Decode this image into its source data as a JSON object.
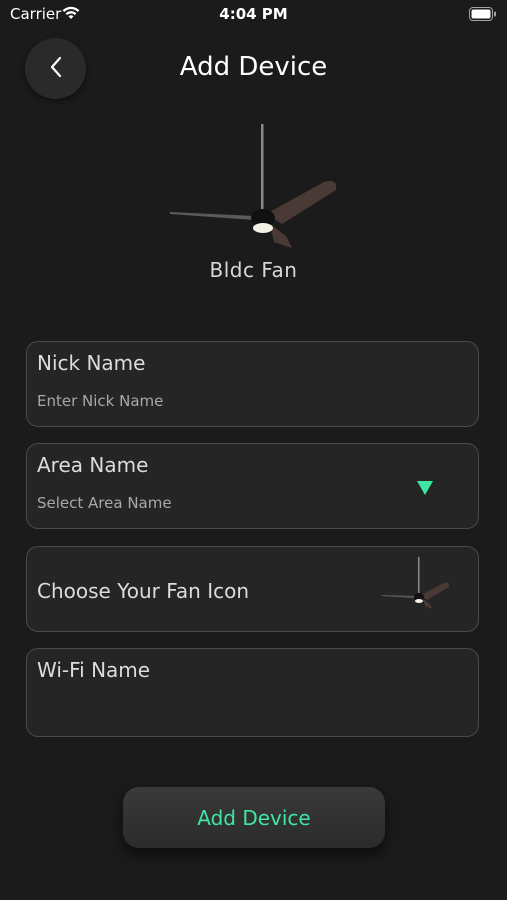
{
  "status_bar": {
    "carrier": "Carrier",
    "time": "4:04 PM"
  },
  "header": {
    "title": "Add Device",
    "back_icon": "chevron-left-icon"
  },
  "device": {
    "type_label": "Bldc Fan",
    "icon": "ceiling-fan-icon"
  },
  "form": {
    "nick_name": {
      "label": "Nick Name",
      "placeholder": "Enter Nick Name",
      "value": ""
    },
    "area_name": {
      "label": "Area Name",
      "placeholder": "Select Area Name",
      "icon": "triangle-down-icon"
    },
    "fan_icon": {
      "label": "Choose Your Fan Icon",
      "icon": "ceiling-fan-icon"
    },
    "wifi_name": {
      "label": "Wi-Fi Name",
      "value": ""
    }
  },
  "actions": {
    "submit_label": "Add Device"
  },
  "colors": {
    "background": "#1b1b1b",
    "card": "#252525",
    "card_border": "#4a4a4a",
    "accent": "#3ee6a2"
  }
}
